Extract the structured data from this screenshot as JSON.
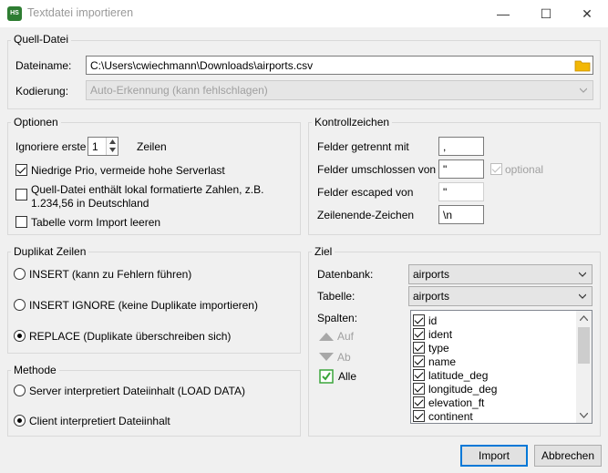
{
  "window": {
    "title": "Textdatei importieren",
    "app_badge": "HS",
    "minimize": "—",
    "maximize": "☐",
    "close": "✕"
  },
  "source": {
    "legend": "Quell-Datei",
    "filename_label": "Dateiname:",
    "filename_value": "C:\\Users\\cwiechmann\\Downloads\\airports.csv",
    "encoding_label": "Kodierung:",
    "encoding_value": "Auto-Erkennung (kann fehlschlagen)"
  },
  "options": {
    "legend": "Optionen",
    "ignore_label": "Ignoriere erste",
    "ignore_value": "1",
    "rows_label": "Zeilen",
    "low_prio": {
      "label": "Niedrige Prio, vermeide hohe Serverlast",
      "checked": true
    },
    "local_numbers": {
      "label_line1": "Quell-Datei enthält lokal formatierte Zahlen, z.B.",
      "label_line2": "1.234,56 in Deutschland",
      "checked": false
    },
    "truncate": {
      "label": "Tabelle vorm Import leeren",
      "checked": false
    }
  },
  "control": {
    "legend": "Kontrollzeichen",
    "separated_label": "Felder getrennt mit",
    "separated_value": ",",
    "enclosed_label": "Felder umschlossen von",
    "enclosed_value": "\"",
    "optional_label": "optional",
    "escaped_label": "Felder escaped von",
    "escaped_value": "\"",
    "lineend_label": "Zeilenende-Zeichen",
    "lineend_value": "\\n"
  },
  "duplicates": {
    "legend": "Duplikat Zeilen",
    "insert": "INSERT (kann zu Fehlern führen)",
    "insert_ignore": "INSERT IGNORE (keine Duplikate importieren)",
    "replace": "REPLACE (Duplikate überschreiben sich)",
    "selected": "replace"
  },
  "method": {
    "legend": "Methode",
    "server": "Server interpretiert Dateiinhalt (LOAD DATA)",
    "client": "Client interpretiert Dateiinhalt",
    "selected": "client"
  },
  "target": {
    "legend": "Ziel",
    "database_label": "Datenbank:",
    "database_value": "airports",
    "table_label": "Tabelle:",
    "table_value": "airports",
    "columns_label": "Spalten:",
    "up_label": "Auf",
    "down_label": "Ab",
    "all_label": "Alle",
    "columns": [
      "id",
      "ident",
      "type",
      "name",
      "latitude_deg",
      "longitude_deg",
      "elevation_ft",
      "continent"
    ]
  },
  "buttons": {
    "import": "Import",
    "cancel": "Abbrechen"
  },
  "colors": {
    "accent": "#0078d7",
    "folder": "#f2b705",
    "green": "#3aa53a"
  }
}
